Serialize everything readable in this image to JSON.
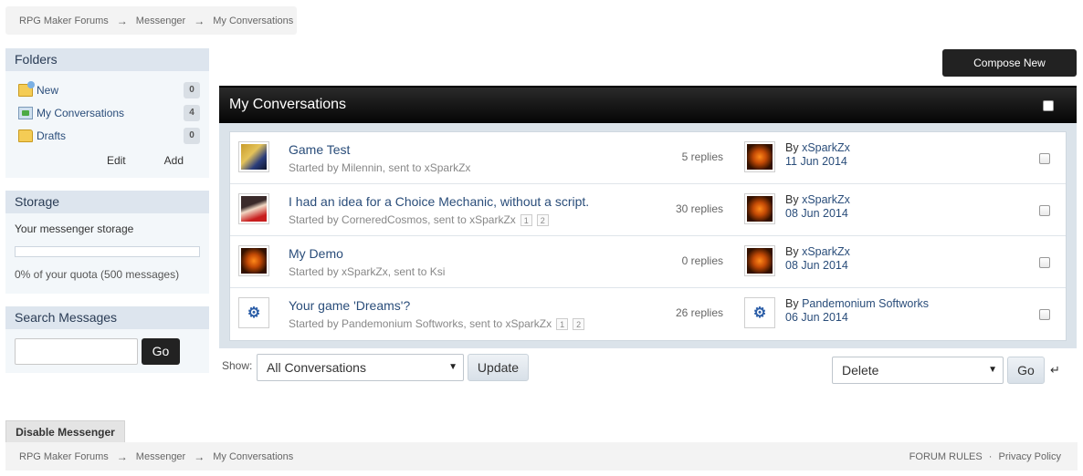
{
  "breadcrumb": {
    "items": [
      "RPG Maker Forums",
      "Messenger",
      "My Conversations"
    ],
    "separator": "→"
  },
  "sidebar": {
    "folders": {
      "title": "Folders",
      "items": [
        {
          "label": "New",
          "count": "0",
          "icon": "new-folder-icon"
        },
        {
          "label": "My Conversations",
          "count": "4",
          "icon": "inbox-icon"
        },
        {
          "label": "Drafts",
          "count": "0",
          "icon": "folder-icon"
        }
      ],
      "edit_label": "Edit",
      "add_label": "Add"
    },
    "storage": {
      "title": "Storage",
      "description": "Your messenger storage",
      "quota_text": "0% of your quota (500 messages)",
      "quota_percent": 0
    },
    "search": {
      "title": "Search Messages",
      "value": "",
      "go_label": "Go"
    },
    "disable_label": "Disable Messenger"
  },
  "compose_label": "Compose New",
  "main": {
    "title": "My Conversations",
    "conversations": [
      {
        "title": "Game Test",
        "meta": "Started by Milennin, sent to xSparkZx",
        "pages": [],
        "replies": "5 replies",
        "last_by_prefix": "By ",
        "last_user": "xSparkZx",
        "last_date": "11 Jun 2014"
      },
      {
        "title": "I had an idea for a Choice Mechanic, without a script.",
        "meta": "Started by CorneredCosmos, sent to xSparkZx",
        "pages": [
          "1",
          "2"
        ],
        "replies": "30 replies",
        "last_by_prefix": "By ",
        "last_user": "xSparkZx",
        "last_date": "08 Jun 2014"
      },
      {
        "title": "My Demo",
        "meta": "Started by xSparkZx, sent to Ksi",
        "pages": [],
        "replies": "0 replies",
        "last_by_prefix": "By ",
        "last_user": "xSparkZx",
        "last_date": "08 Jun 2014"
      },
      {
        "title": "Your game 'Dreams'?",
        "meta": "Started by Pandemonium Softworks, sent to xSparkZx",
        "pages": [
          "1",
          "2"
        ],
        "replies": "26 replies",
        "last_by_prefix": "By ",
        "last_user": "Pandemonium Softworks",
        "last_date": "06 Jun 2014"
      }
    ]
  },
  "controls": {
    "show_label": "Show:",
    "filter_value": "All Conversations",
    "update_label": "Update",
    "action_value": "Delete",
    "go_label": "Go",
    "return_icon": "↵"
  },
  "footer": {
    "rules_label": "FORUM RULES",
    "privacy_label": "Privacy Policy",
    "separator": "·"
  }
}
